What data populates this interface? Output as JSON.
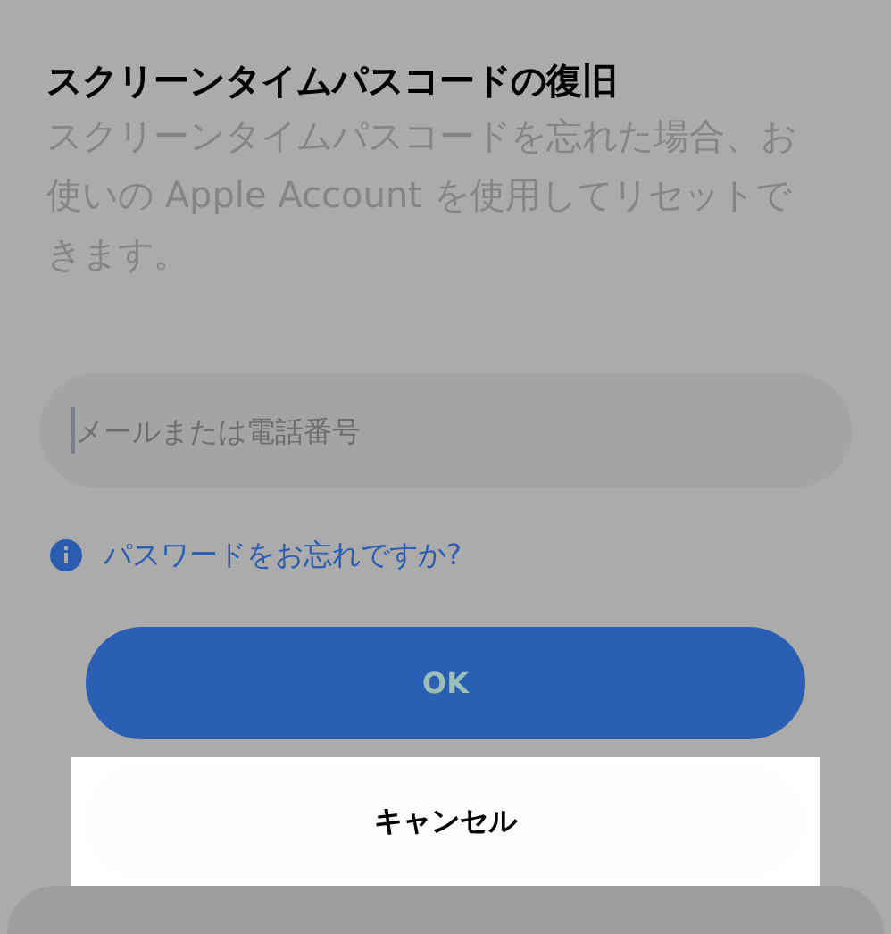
{
  "dialog": {
    "title": "スクリーンタイムパスコードの復旧",
    "description": "スクリーンタイムパスコードを忘れた場合、お使いの Apple Account を使用してリセットできます。"
  },
  "field": {
    "placeholder": "メールまたは電話番号"
  },
  "forgot_link": "パスワードをお忘れですか?",
  "buttons": [
    {
      "label": "OK",
      "kind": "primary"
    },
    {
      "label": "キャンセル",
      "kind": "secondary"
    }
  ]
}
